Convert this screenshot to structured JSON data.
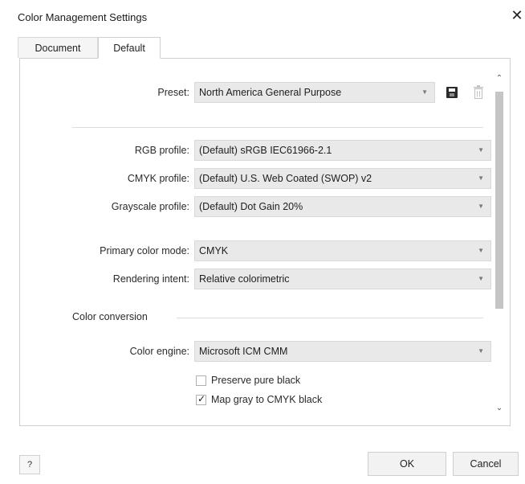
{
  "window": {
    "title": "Color Management Settings",
    "close_icon": "close-icon"
  },
  "tabs": [
    {
      "label": "Document",
      "active": false
    },
    {
      "label": "Default",
      "active": true
    }
  ],
  "preset": {
    "label": "Preset:",
    "value": "North America General Purpose",
    "save_icon": "save-icon",
    "delete_icon": "trash-icon"
  },
  "profiles": {
    "rgb": {
      "label": "RGB profile:",
      "value": "(Default) sRGB IEC61966-2.1"
    },
    "cmyk": {
      "label": "CMYK profile:",
      "value": "(Default) U.S. Web Coated (SWOP) v2"
    },
    "grayscale": {
      "label": "Grayscale profile:",
      "value": "(Default) Dot Gain 20%"
    }
  },
  "modes": {
    "primary": {
      "label": "Primary color mode:",
      "value": "CMYK"
    },
    "rendering": {
      "label": "Rendering intent:",
      "value": "Relative colorimetric"
    }
  },
  "conversion": {
    "heading": "Color conversion",
    "engine": {
      "label": "Color engine:",
      "value": "Microsoft ICM CMM"
    },
    "preserve_black": {
      "label": "Preserve pure black",
      "checked": false
    },
    "map_gray": {
      "label": "Map gray to CMYK black",
      "checked": true
    }
  },
  "footer": {
    "help": "?",
    "ok": "OK",
    "cancel": "Cancel"
  },
  "colors": {
    "dropdown_bg": "#e9e9e9",
    "panel_border": "#d0d0d0",
    "scroll_thumb": "#c5c5c5"
  }
}
